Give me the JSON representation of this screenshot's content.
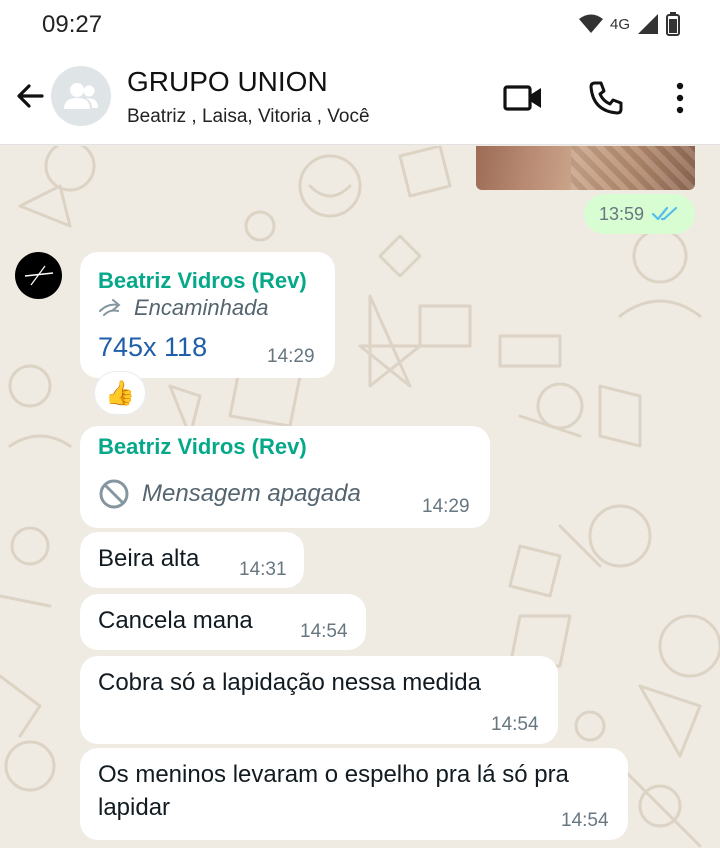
{
  "status_bar": {
    "time": "09:27",
    "network": "4G"
  },
  "header": {
    "group_name": "GRUPO UNION",
    "participants": "Beatriz , Laisa, Vitoria , Você"
  },
  "outgoing": {
    "time": "13:59",
    "read_status": "read"
  },
  "messages": [
    {
      "sender": "Beatriz Vidros (Rev)",
      "forwarded_label": "Encaminhada",
      "text": "745x 118",
      "time": "14:29",
      "reaction": "👍"
    },
    {
      "sender": "Beatriz Vidros (Rev)",
      "deleted_text": "Mensagem apagada",
      "time": "14:29"
    },
    {
      "text": "Beira alta",
      "time": "14:31"
    },
    {
      "text": "Cancela mana",
      "time": "14:54"
    },
    {
      "text": "Cobra só a lapidação nessa medida",
      "time": "14:54"
    },
    {
      "text": "Os meninos levaram o espelho pra lá só pra lapidar",
      "time": "14:54"
    }
  ],
  "colors": {
    "sender_name": "#06a88a",
    "outgoing_bubble": "#d9fdd3",
    "link": "#1f5ea8",
    "read_ticks": "#53bdeb"
  }
}
